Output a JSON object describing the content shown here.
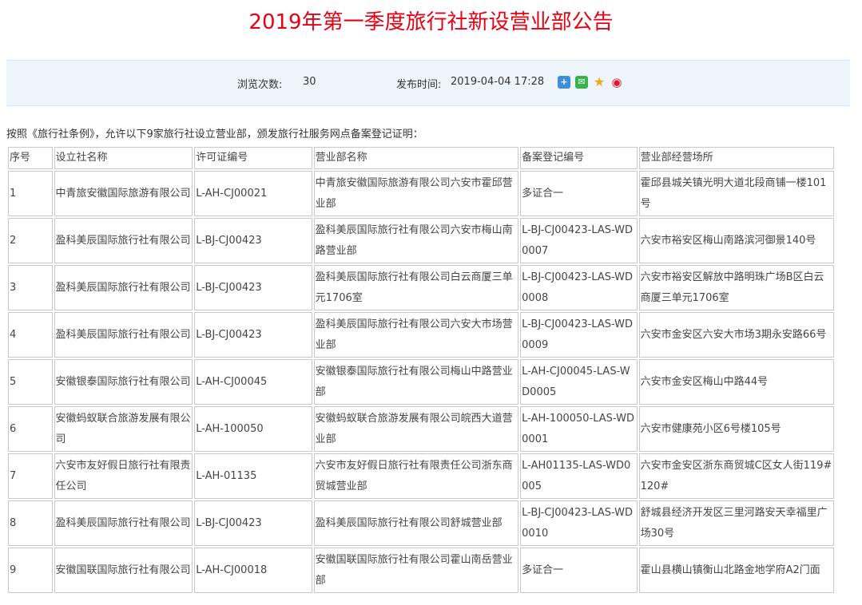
{
  "page": {
    "title": "2019年第一季度旅行社新设营业部公告"
  },
  "meta": {
    "views_label": "浏览次数:",
    "views_value": "30",
    "date_label": "发布时间:",
    "date_value": "2019-04-04 17:28",
    "share_icons": [
      "share-plus-icon",
      "wechat-icon",
      "qzone-icon",
      "weibo-icon"
    ]
  },
  "intro": "按照《旅行社条例》，允许以下9家旅行社设立营业部，颁发旅行社服务网点备案登记证明：",
  "table": {
    "headers": [
      "序号",
      "设立社名称",
      "许可证编号",
      "营业部名称",
      "备案登记编号",
      "营业部经营场所"
    ],
    "rows": [
      [
        "1",
        "中青旅安徽国际旅游有限公司",
        "L-AH-CJ00021",
        "中青旅安徽国际旅游有限公司六安市霍邱营业部",
        "多证合一",
        "霍邱县城关镇光明大道北段商铺一楼101号"
      ],
      [
        "2",
        "盈科美辰国际旅行社有限公司",
        "L-BJ-CJ00423",
        "盈科美辰国际旅行社有限公司六安市梅山南路营业部",
        "L-BJ-CJ00423-LAS-WD0007",
        "六安市裕安区梅山南路滨河御景140号"
      ],
      [
        "3",
        "盈科美辰国际旅行社有限公司",
        "L-BJ-CJ00423",
        "盈科美辰国际旅行社有限公司白云商厦三单元1706室",
        "L-BJ-CJ00423-LAS-WD0008",
        "六安市裕安区解放中路明珠广场B区白云商厦三单元1706室"
      ],
      [
        "4",
        "盈科美辰国际旅行社有限公司",
        "L-BJ-CJ00423",
        "盈科美辰国际旅行社有限公司六安大市场营业部",
        "L-BJ-CJ00423-LAS-WD0009",
        "六安市金安区六安大市场3期永安路66号"
      ],
      [
        "5",
        "安徽银泰国际旅行社有限公司",
        "L-AH-CJ00045",
        "安徽银泰国际旅行社有限公司梅山中路营业部",
        "L-AH-CJ00045-LAS-WD0005",
        "六安市金安区梅山中路44号"
      ],
      [
        "6",
        "安徽蚂蚁联合旅游发展有限公司",
        "L-AH-100050",
        "安徽蚂蚁联合旅游发展有限公司皖西大道营业部",
        "L-AH-100050-LAS-WD0001",
        "六安市健康苑小区6号楼105号"
      ],
      [
        "7",
        "六安市友好假日旅行社有限责任公司",
        "L-AH-01135",
        "六安市友好假日旅行社有限责任公司浙东商贸城营业部",
        "L-AH01135-LAS-WD0005",
        "六安市金安区浙东商贸城C区女人街119#120#"
      ],
      [
        "8",
        "盈科美辰国际旅行社有限公司",
        "L-BJ-CJ00423",
        "盈科美辰国际旅行社有限公司舒城营业部",
        "L-BJ-CJ00423-LAS-WD0010",
        "舒城县经济开发区三里河路安天幸福里广场30号"
      ],
      [
        "9",
        "安徽国联国际旅行社有限公司",
        "L-AH-CJ00018",
        "安徽国联国际旅行社有限公司霍山南岳营业部",
        "多证合一",
        "霍山县横山镇衡山北路金地学府A2门面"
      ]
    ]
  }
}
